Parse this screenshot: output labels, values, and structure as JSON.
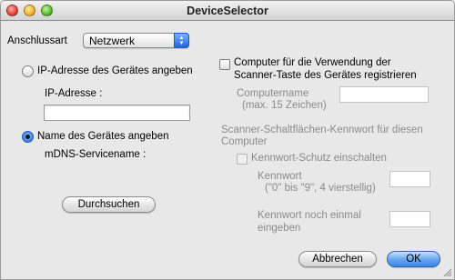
{
  "window": {
    "title": "DeviceSelector"
  },
  "connection": {
    "label": "Anschlussart",
    "selected": "Netzwerk"
  },
  "ip_option": {
    "label": "IP-Adresse des Gerätes angeben",
    "field_label": "IP-Adresse :",
    "value": ""
  },
  "name_option": {
    "label": "Name des Gerätes angeben",
    "field_label": "mDNS-Servicename :"
  },
  "browse_button": "Durchsuchen",
  "scanner_register": {
    "label_line1": "Computer für die Verwendung der",
    "label_line2": "Scanner-Taste des Gerätes registrieren",
    "computer_name_label": "Computername",
    "computer_name_hint": "(max. 15 Zeichen)",
    "computer_name_value": ""
  },
  "password_section": {
    "heading_line1": "Scanner-Schaltflächen-Kennwort für diesen",
    "heading_line2": "Computer",
    "enable_label": "Kennwort-Schutz einschalten",
    "password_label": "Kennwort",
    "password_hint": "(\"0\" bis \"9\", 4 vierstellig)",
    "password_value": "",
    "repeat_label_line1": "Kennwort noch einmal",
    "repeat_label_line2": "eingeben",
    "repeat_value": ""
  },
  "footer": {
    "cancel": "Abbrechen",
    "ok": "OK"
  }
}
